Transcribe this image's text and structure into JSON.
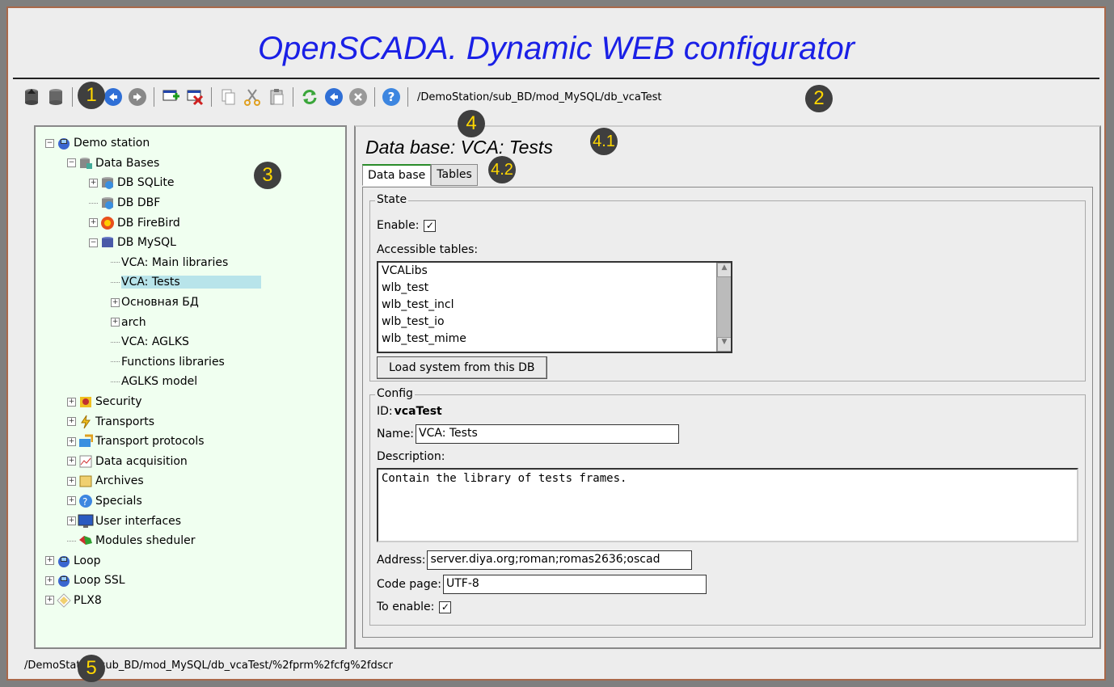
{
  "app": {
    "title": "OpenSCADA. Dynamic WEB configurator"
  },
  "toolbar": {
    "buttons": [
      "db-load-icon",
      "db-save-icon",
      "up-icon",
      "back-icon",
      "forward-icon",
      "add-icon",
      "delete-icon",
      "copy-icon",
      "cut-icon",
      "paste-icon",
      "refresh-icon",
      "start-icon",
      "stop-icon",
      "help-icon"
    ],
    "path": "/DemoStation/sub_BD/mod_MySQL/db_vcaTest"
  },
  "markers": {
    "m1": "1",
    "m2": "2",
    "m3": "3",
    "m4": "4",
    "m41": "4.1",
    "m42": "4.2",
    "m5": "5"
  },
  "tree": {
    "items": [
      {
        "label": "Demo station",
        "level": 0,
        "expander": "−",
        "icon": "station-icon"
      },
      {
        "label": "Data Bases",
        "level": 1,
        "expander": "−",
        "icon": "databases-icon"
      },
      {
        "label": "DB SQLite",
        "level": 2,
        "expander": "+",
        "icon": "db-sqlite-icon"
      },
      {
        "label": "DB DBF",
        "level": 2,
        "expander": "",
        "icon": "db-dbf-icon"
      },
      {
        "label": "DB FireBird",
        "level": 2,
        "expander": "+",
        "icon": "db-firebird-icon"
      },
      {
        "label": "DB MySQL",
        "level": 2,
        "expander": "−",
        "icon": "db-mysql-icon"
      },
      {
        "label": "VCA: Main libraries",
        "level": 3,
        "expander": "",
        "icon": ""
      },
      {
        "label": "VCA: Tests",
        "level": 3,
        "expander": "",
        "icon": "",
        "selected": true
      },
      {
        "label": "Основная БД",
        "level": 3,
        "expander": "+",
        "icon": ""
      },
      {
        "label": "arch",
        "level": 3,
        "expander": "+",
        "icon": ""
      },
      {
        "label": "VCA: AGLKS",
        "level": 3,
        "expander": "",
        "icon": ""
      },
      {
        "label": "Functions libraries",
        "level": 3,
        "expander": "",
        "icon": ""
      },
      {
        "label": "AGLKS model",
        "level": 3,
        "expander": "",
        "icon": ""
      },
      {
        "label": "Security",
        "level": 1,
        "expander": "+",
        "icon": "security-icon"
      },
      {
        "label": "Transports",
        "level": 1,
        "expander": "+",
        "icon": "transports-icon"
      },
      {
        "label": "Transport protocols",
        "level": 1,
        "expander": "+",
        "icon": "protocols-icon"
      },
      {
        "label": "Data acquisition",
        "level": 1,
        "expander": "+",
        "icon": "daq-icon"
      },
      {
        "label": "Archives",
        "level": 1,
        "expander": "+",
        "icon": "archives-icon"
      },
      {
        "label": "Specials",
        "level": 1,
        "expander": "+",
        "icon": "specials-icon"
      },
      {
        "label": "User interfaces",
        "level": 1,
        "expander": "+",
        "icon": "ui-icon"
      },
      {
        "label": "Modules sheduler",
        "level": 1,
        "expander": "",
        "icon": "sheduler-icon"
      },
      {
        "label": "Loop",
        "level": 0,
        "expander": "+",
        "icon": "station-icon"
      },
      {
        "label": "Loop SSL",
        "level": 0,
        "expander": "+",
        "icon": "station-icon"
      },
      {
        "label": "PLX8",
        "level": 0,
        "expander": "+",
        "icon": "plx-icon"
      }
    ]
  },
  "page": {
    "header": "Data base: VCA: Tests",
    "tabs": [
      "Data base",
      "Tables"
    ],
    "state": {
      "title": "State",
      "enable_label": "Enable:",
      "enable_checked": true,
      "tables_label": "Accessible tables:",
      "tables": [
        "VCALibs",
        "wlb_test",
        "wlb_test_incl",
        "wlb_test_io",
        "wlb_test_mime"
      ],
      "load_button": "Load system from this DB"
    },
    "config": {
      "title": "Config",
      "id_label": "ID:",
      "id_value": "vcaTest",
      "name_label": "Name:",
      "name_value": "VCA: Tests",
      "descr_label": "Description:",
      "descr_value": "Contain the library of tests frames.",
      "address_label": "Address:",
      "address_value": "server.diya.org;roman;romas2636;oscad",
      "codepage_label": "Code page:",
      "codepage_value": "UTF-8",
      "toenable_label": "To enable:",
      "toenable_checked": true
    }
  },
  "status": "/DemoStation/sub_BD/mod_MySQL/db_vcaTest/%2fprm%2fcfg%2fdscr"
}
